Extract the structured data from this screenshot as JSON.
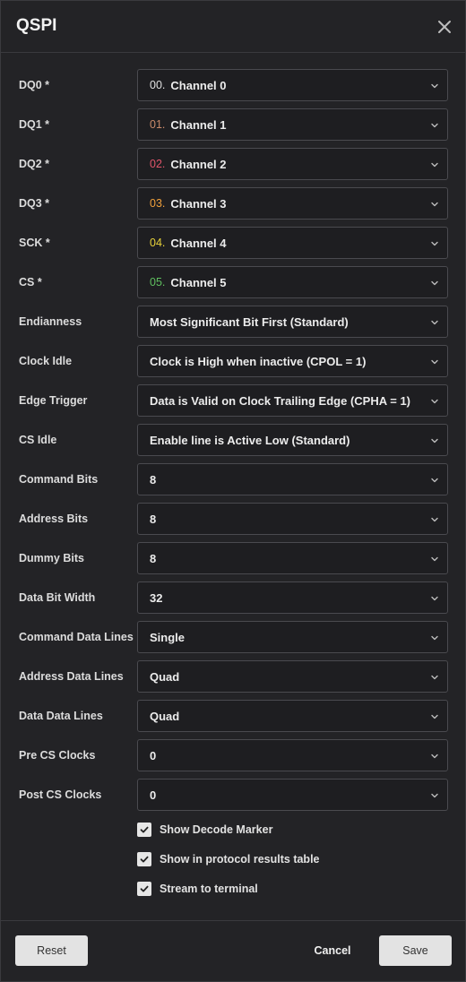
{
  "dialog": {
    "title": "QSPI"
  },
  "fields": [
    {
      "label": "DQ0 *",
      "prefix": "00.",
      "prefix_color": "#e0e0e0",
      "value": "Channel 0"
    },
    {
      "label": "DQ1 *",
      "prefix": "01.",
      "prefix_color": "#c98a6a",
      "value": "Channel 1"
    },
    {
      "label": "DQ2 *",
      "prefix": "02.",
      "prefix_color": "#e0556a",
      "value": "Channel 2"
    },
    {
      "label": "DQ3 *",
      "prefix": "03.",
      "prefix_color": "#f0a03c",
      "value": "Channel 3"
    },
    {
      "label": "SCK *",
      "prefix": "04.",
      "prefix_color": "#e8d23a",
      "value": "Channel 4"
    },
    {
      "label": "CS *",
      "prefix": "05.",
      "prefix_color": "#5fbf5f",
      "value": "Channel 5"
    },
    {
      "label": "Endianness",
      "prefix": "",
      "value": "Most Significant Bit First (Standard)"
    },
    {
      "label": "Clock Idle",
      "prefix": "",
      "value": "Clock is High when inactive (CPOL = 1)"
    },
    {
      "label": "Edge Trigger",
      "prefix": "",
      "value": "Data is Valid on Clock Trailing Edge (CPHA = 1)"
    },
    {
      "label": "CS Idle",
      "prefix": "",
      "value": "Enable line is Active Low (Standard)"
    },
    {
      "label": "Command Bits",
      "prefix": "",
      "value": "8"
    },
    {
      "label": "Address Bits",
      "prefix": "",
      "value": "8"
    },
    {
      "label": "Dummy Bits",
      "prefix": "",
      "value": "8"
    },
    {
      "label": "Data Bit Width",
      "prefix": "",
      "value": "32"
    },
    {
      "label": "Command Data Lines",
      "prefix": "",
      "value": "Single"
    },
    {
      "label": "Address Data Lines",
      "prefix": "",
      "value": "Quad"
    },
    {
      "label": "Data Data Lines",
      "prefix": "",
      "value": "Quad"
    },
    {
      "label": "Pre CS Clocks",
      "prefix": "",
      "value": "0"
    },
    {
      "label": "Post CS Clocks",
      "prefix": "",
      "value": "0"
    }
  ],
  "checkboxes": [
    {
      "label": "Show Decode Marker",
      "checked": true
    },
    {
      "label": "Show in protocol results table",
      "checked": true
    },
    {
      "label": "Stream to terminal",
      "checked": true
    }
  ],
  "buttons": {
    "reset": "Reset",
    "cancel": "Cancel",
    "save": "Save"
  },
  "icons": {
    "close": "close-icon",
    "dropdown": "chevron-down-icon",
    "check": "checkmark-icon"
  }
}
